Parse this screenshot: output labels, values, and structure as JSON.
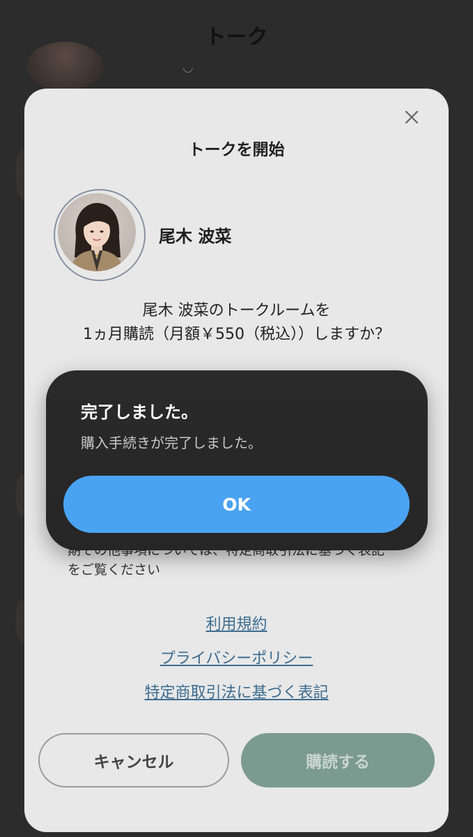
{
  "page": {
    "title": "トーク"
  },
  "modal": {
    "title": "トークを開始",
    "close_icon": "close-icon",
    "profile_name": "尾木 波菜",
    "question_line1": "尾木 波菜のトークルームを",
    "question_line2": "1ヵ月購読（月額￥550（税込））しますか？",
    "notice_line1": "期その他事項については、特定商取引法に基づく表記",
    "notice_line2": "をご覧ください",
    "links": {
      "terms": "利用規約",
      "privacy": "プライバシーポリシー",
      "tokusho": "特定商取引法に基づく表記"
    },
    "cancel_label": "キャンセル",
    "subscribe_label": "購読する"
  },
  "alert": {
    "title": "完了しました。",
    "message": "購入手続きが完了しました。",
    "ok_label": "OK"
  },
  "colors": {
    "ok_button": "#4aa3f2",
    "subscribe_button": "#7b9a90",
    "link": "#3d6c8f"
  }
}
